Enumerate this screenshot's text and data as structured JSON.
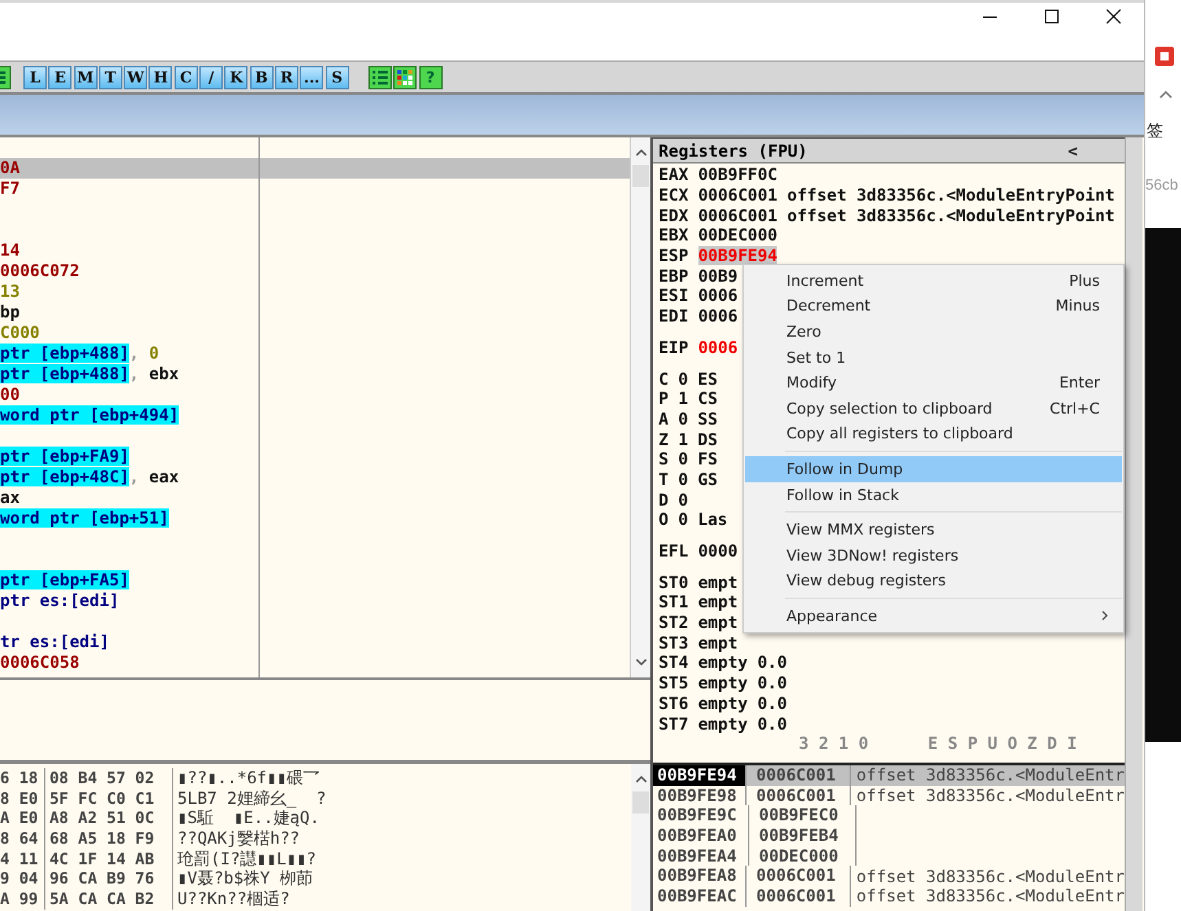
{
  "toolbar": {
    "buttons": [
      "L",
      "E",
      "M",
      "T",
      "W",
      "H",
      "C",
      "/",
      "K",
      "B",
      "R",
      "...",
      "S"
    ],
    "help_button": "?"
  },
  "disassembly": {
    "rows": [
      {
        "selected": true,
        "segments": [
          {
            "text": "0A",
            "kind": "number"
          }
        ]
      },
      {
        "selected": false,
        "segments": [
          {
            "text": "F7",
            "kind": "number"
          }
        ]
      },
      {
        "selected": false
      },
      {
        "selected": false
      },
      {
        "selected": false,
        "segments": [
          {
            "text": "14",
            "kind": "number"
          }
        ]
      },
      {
        "selected": false,
        "segments": [
          {
            "text": "0006C072",
            "kind": "number"
          }
        ]
      },
      {
        "selected": false,
        "segments": [
          {
            "text": "13",
            "kind": "immediate"
          }
        ]
      },
      {
        "selected": false,
        "segments": [
          {
            "text": "bp",
            "kind": "register"
          }
        ]
      },
      {
        "selected": false,
        "segments": [
          {
            "text": "C000",
            "kind": "immediate"
          }
        ]
      },
      {
        "selected": false,
        "segments": [
          {
            "text": "ptr [ebp+488]",
            "kind": "memory"
          },
          {
            "text": ", ",
            "kind": "comma"
          },
          {
            "text": "0",
            "kind": "immediate"
          }
        ]
      },
      {
        "selected": false,
        "segments": [
          {
            "text": "ptr [ebp+488]",
            "kind": "memory"
          },
          {
            "text": ", ",
            "kind": "comma"
          },
          {
            "text": "ebx",
            "kind": "register"
          }
        ]
      },
      {
        "selected": false,
        "segments": [
          {
            "text": "00",
            "kind": "number"
          }
        ]
      },
      {
        "selected": false,
        "segments": [
          {
            "text": "word ptr [ebp+494]",
            "kind": "memory"
          }
        ]
      },
      {
        "selected": false
      },
      {
        "selected": false,
        "segments": [
          {
            "text": "ptr [ebp+FA9]",
            "kind": "memory"
          }
        ]
      },
      {
        "selected": false,
        "segments": [
          {
            "text": "ptr [ebp+48C]",
            "kind": "memory"
          },
          {
            "text": ", ",
            "kind": "comma"
          },
          {
            "text": "eax",
            "kind": "register"
          }
        ]
      },
      {
        "selected": false,
        "segments": [
          {
            "text": "ax",
            "kind": "register"
          }
        ]
      },
      {
        "selected": false,
        "segments": [
          {
            "text": "word ptr [ebp+51]",
            "kind": "memory"
          }
        ]
      },
      {
        "selected": false
      },
      {
        "selected": false
      },
      {
        "selected": false,
        "segments": [
          {
            "text": "ptr [ebp+FA5]",
            "kind": "memory"
          }
        ]
      },
      {
        "selected": false,
        "segments": [
          {
            "text": "ptr es:[edi]",
            "kind": "operand"
          }
        ]
      },
      {
        "selected": false
      },
      {
        "selected": false,
        "segments": [
          {
            "text": "tr es:[edi]",
            "kind": "operand"
          }
        ]
      },
      {
        "selected": false,
        "segments": [
          {
            "text": "0006C058",
            "kind": "number"
          }
        ]
      }
    ]
  },
  "registers": {
    "title": "Registers (FPU)",
    "nav_button": "<",
    "sections": [
      [
        {
          "label": "EAX",
          "value": "00B9FF0C",
          "changed": false,
          "selected": false
        },
        {
          "label": "ECX",
          "value": "0006C001",
          "note": "offset 3d83356c.<ModuleEntryPoint",
          "changed": false,
          "selected": false
        },
        {
          "label": "EDX",
          "value": "0006C001",
          "note": "offset 3d83356c.<ModuleEntryPoint",
          "changed": false,
          "selected": false
        },
        {
          "label": "EBX",
          "value": "00DEC000",
          "changed": false,
          "selected": false
        },
        {
          "label": "ESP",
          "value": "00B9FE94",
          "changed": true,
          "selected": true
        },
        {
          "label": "EBP",
          "value": "00B9",
          "changed": false,
          "selected": false
        },
        {
          "label": "ESI",
          "value": "0006",
          "changed": false,
          "selected": false
        },
        {
          "label": "EDI",
          "value": "0006",
          "changed": false,
          "selected": false
        }
      ],
      [
        {
          "label": "EIP",
          "value": "0006",
          "changed": true,
          "selected": false
        }
      ],
      [
        {
          "label": "C",
          "value": "0",
          "note": "ES"
        },
        {
          "label": "P",
          "value": "1",
          "note": "CS"
        },
        {
          "label": "A",
          "value": "0",
          "note": "SS"
        },
        {
          "label": "Z",
          "value": "1",
          "note": "DS"
        },
        {
          "label": "S",
          "value": "0",
          "note": "FS"
        },
        {
          "label": "T",
          "value": "0",
          "note": "GS"
        },
        {
          "label": "D",
          "value": "0"
        },
        {
          "label": "O",
          "value": "0",
          "note": "Las"
        }
      ],
      [
        {
          "label": "EFL",
          "value": "0000"
        }
      ],
      [
        {
          "label": "ST0",
          "value": "empt"
        },
        {
          "label": "ST1",
          "value": "empt"
        },
        {
          "label": "ST2",
          "value": "empt"
        },
        {
          "label": "ST3",
          "value": "empt"
        },
        {
          "label": "ST4",
          "value": "empty",
          "note": "0.0"
        },
        {
          "label": "ST5",
          "value": "empty",
          "note": "0.0"
        },
        {
          "label": "ST6",
          "value": "empty",
          "note": "0.0"
        },
        {
          "label": "ST7",
          "value": "empty",
          "note": "0.0"
        },
        {
          "kind": "scale",
          "label": "3 2 1 0      E S P U O Z D I"
        }
      ]
    ]
  },
  "context_menu": {
    "groups": [
      [
        {
          "label": "Increment",
          "shortcut": "Plus",
          "selected": false
        },
        {
          "label": "Decrement",
          "shortcut": "Minus",
          "selected": false
        },
        {
          "label": "Zero",
          "selected": false
        },
        {
          "label": "Set to 1",
          "selected": false
        },
        {
          "label": "Modify",
          "shortcut": "Enter",
          "selected": false
        },
        {
          "label": "Copy selection to clipboard",
          "shortcut": "Ctrl+C",
          "selected": false
        },
        {
          "label": "Copy all registers to clipboard",
          "selected": false
        }
      ],
      [
        {
          "label": "Follow in Dump",
          "selected": true
        },
        {
          "label": "Follow in Stack",
          "selected": false
        }
      ],
      [
        {
          "label": "View MMX registers",
          "selected": false
        },
        {
          "label": "View 3DNow! registers",
          "selected": false
        },
        {
          "label": "View debug registers",
          "selected": false
        }
      ],
      [
        {
          "label": "Appearance",
          "submenu": true,
          "selected": false
        }
      ]
    ]
  },
  "dump": {
    "rows": [
      {
        "col_1": "6 18",
        "col_2": "08 B4 57 02",
        "ascii": "▮??▮..*6f▮▮碨乛"
      },
      {
        "col_1": "8 E0",
        "col_2": "5F FC C0 C1",
        "ascii": "5LB7 2娌締幺_  ?"
      },
      {
        "col_1": "A E0",
        "col_2": "A8 A2 51 0C",
        "ascii": "▮S駈  ▮E..婕ąQ."
      },
      {
        "col_1": "8 64",
        "col_2": "68 A5 18 F9",
        "ascii": "??QAKj嫛楛h??"
      },
      {
        "col_1": "4 11",
        "col_2": "4C 1F 14 AB",
        "ascii": "玱罰(I?譿▮▮L▮▮?"
      },
      {
        "col_1": "9 04",
        "col_2": "96 CA B9 76",
        "ascii": "▮V聂?b$祩Y 栁莭"
      },
      {
        "col_1": "A 99",
        "col_2": "5A CA CA B2",
        "ascii": "U??Kn??棝适?"
      }
    ]
  },
  "stack": {
    "rows": [
      {
        "address": "00B9FE94",
        "value": "0006C001",
        "comment": "offset 3d83356c.<ModuleEntr",
        "selected": true
      },
      {
        "address": "00B9FE98",
        "value": "0006C001",
        "comment": "offset 3d83356c.<ModuleEntr",
        "selected": false
      },
      {
        "address": "00B9FE9C",
        "value": "00B9FEC0",
        "selected": false
      },
      {
        "address": "00B9FEA0",
        "value": "00B9FEB4",
        "selected": false
      },
      {
        "address": "00B9FEA4",
        "value": "00DEC000",
        "selected": false
      },
      {
        "address": "00B9FEA8",
        "value": "0006C001",
        "comment": "offset 3d83356c.<ModuleEntr",
        "selected": false
      },
      {
        "address": "00B9FEAC",
        "value": "0006C001",
        "comment": "offset 3d83356c.<ModuleEntr",
        "selected": false
      }
    ]
  },
  "side_window": {
    "label": "签",
    "url_fragment": "56cb"
  }
}
